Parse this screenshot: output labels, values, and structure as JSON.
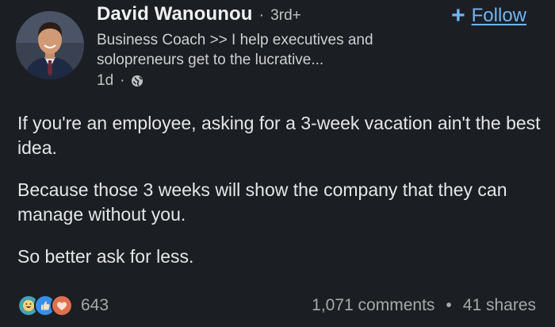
{
  "author": {
    "name": "David Wanounou",
    "separator": "·",
    "degree": "3rd+",
    "headline": "Business Coach >> I help executives and solopreneurs get to the lucrative...",
    "time": "1d",
    "meta_separator": "·",
    "visibility_icon": "globe-icon"
  },
  "follow": {
    "icon": "plus-icon",
    "plus": "+",
    "label": "Follow"
  },
  "post": {
    "paragraphs": [
      "If you're an employee, asking for a 3-week vacation ain't the best idea.",
      "Because those 3 weeks will show the company that they can manage without you.",
      "So better ask for less."
    ]
  },
  "social": {
    "reaction_icons": [
      "funny-icon",
      "like-icon",
      "love-icon"
    ],
    "reaction_count": "643",
    "comments": "1,071 comments",
    "separator": "•",
    "shares": "41 shares"
  },
  "colors": {
    "background": "#1b1f23",
    "link": "#70b5f9",
    "text": "#e6e6e6",
    "muted": "#a8a8a8"
  }
}
